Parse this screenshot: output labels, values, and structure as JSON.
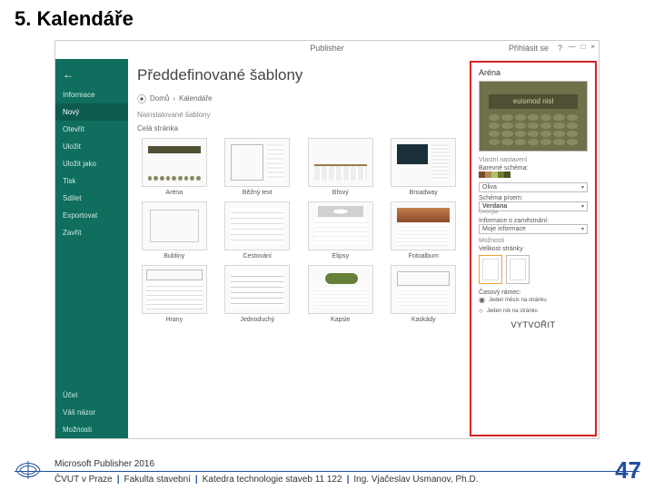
{
  "slide": {
    "title": "5. Kalendáře",
    "page_number": "47"
  },
  "titlebar": {
    "app": "Publisher",
    "signin": "Přihlásit se",
    "help": "?"
  },
  "sidebar": {
    "items": [
      {
        "label": "Informace"
      },
      {
        "label": "Nový",
        "active": true
      },
      {
        "label": "Otevřít"
      },
      {
        "label": "Uložit"
      },
      {
        "label": "Uložit jako"
      },
      {
        "label": "Tisk"
      },
      {
        "label": "Sdílet"
      },
      {
        "label": "Exportovat"
      },
      {
        "label": "Zavřít"
      }
    ],
    "bottom": [
      {
        "label": "Účet"
      },
      {
        "label": "Váš názor"
      },
      {
        "label": "Možnosti"
      }
    ]
  },
  "content": {
    "heading": "Předdefinované šablony",
    "breadcrumb": {
      "home": "Domů",
      "current": "Kalendáře"
    },
    "section": "Nainstalované šablony",
    "filter": "Celá stránka",
    "templates": [
      {
        "name": "Aréna",
        "thumb": "th-arena"
      },
      {
        "name": "Běžný text",
        "thumb": "th-bezny"
      },
      {
        "name": "Břový",
        "thumb": "th-brovy"
      },
      {
        "name": "Broadway",
        "thumb": "th-broadway"
      },
      {
        "name": "Bubliny",
        "thumb": "th-bubliny"
      },
      {
        "name": "Cestování",
        "thumb": "th-cestovani"
      },
      {
        "name": "Elipsy",
        "thumb": "th-elipsy"
      },
      {
        "name": "Fotoalbum",
        "thumb": "th-fotoalbum"
      },
      {
        "name": "Hrany",
        "thumb": "th-hrany"
      },
      {
        "name": "Jednoduchý",
        "thumb": "th-jednoduchy"
      },
      {
        "name": "Kapsle",
        "thumb": "th-kapsle"
      },
      {
        "name": "Kaskády",
        "thumb": "th-kaskady"
      }
    ]
  },
  "preview": {
    "title": "Aréna",
    "banner_text": "euismod nisl",
    "groups": {
      "custom": "Vlastní nastavení",
      "color_scheme": "Barevné schéma:",
      "color_value": "Oliva",
      "font_scheme": "Schéma písem:",
      "font_value": "Verdana",
      "font_sub": "Georgia",
      "business": "Informace o zaměstnání:",
      "business_value": "Moje informace",
      "options": "Možnosti",
      "page_size": "Velikost stránky",
      "timeframe": "Časový rámec:",
      "tf_opt1": "Jeden měsíc na stránku",
      "tf_opt2": "Jeden rok na stránku"
    },
    "swatches": [
      "#7a4d2a",
      "#b58a54",
      "#b0c070",
      "#6b7a30",
      "#4a5020"
    ],
    "create": "VYTVOŘIT"
  },
  "footer": {
    "product": "Microsoft Publisher 2016",
    "parts": [
      "ČVUT v Praze",
      "Fakulta stavební",
      "Katedra technologie staveb 11 122",
      "Ing. Vjačeslav Usmanov, Ph.D."
    ]
  }
}
